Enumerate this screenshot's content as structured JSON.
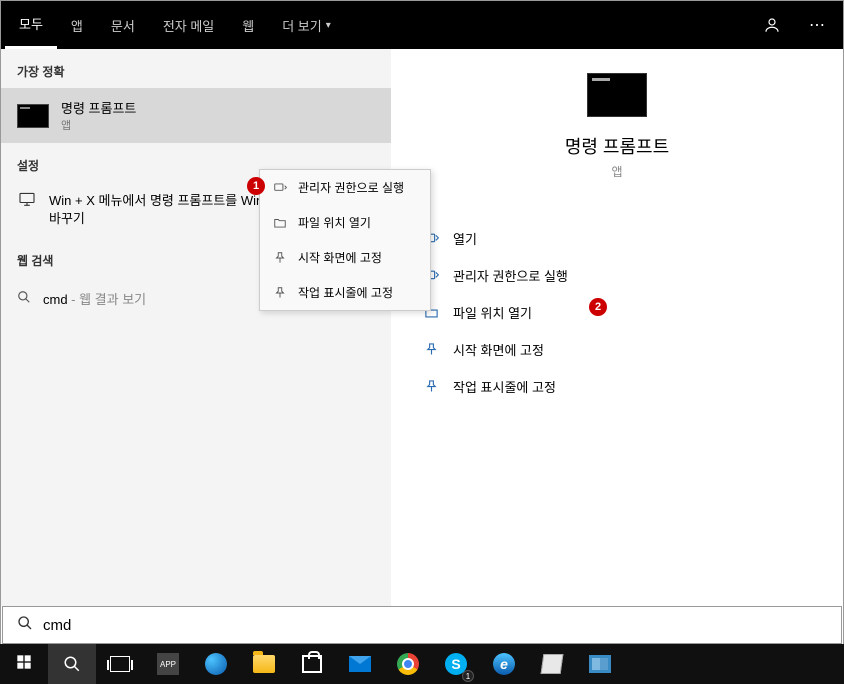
{
  "tabs": {
    "all": "모두",
    "apps": "앱",
    "docs": "문서",
    "email": "전자 메일",
    "web": "웹",
    "more": "더 보기"
  },
  "left": {
    "best_match_header": "가장 정확",
    "result_title": "명령 프롬프트",
    "result_sub": "앱",
    "settings_header": "설정",
    "setting_text": "Win + X 메뉴에서 명령 프롬프트를 Windows PowerShell로 바꾸기",
    "web_header": "웹 검색",
    "web_query": "cmd",
    "web_hint": " - 웹 결과 보기"
  },
  "context_menu": {
    "run_admin": "관리자 권한으로 실행",
    "open_loc": "파일 위치 열기",
    "pin_start": "시작 화면에 고정",
    "pin_taskbar": "작업 표시줄에 고정"
  },
  "preview": {
    "title": "명령 프롬프트",
    "sub": "앱",
    "open": "열기",
    "run_admin": "관리자 권한으로 실행",
    "open_loc": "파일 위치 열기",
    "pin_start": "시작 화면에 고정",
    "pin_taskbar": "작업 표시줄에 고정"
  },
  "badges": {
    "b1": "1",
    "b2": "2"
  },
  "search": {
    "value": "cmd"
  },
  "taskbar": {
    "skype_badge": "1"
  }
}
